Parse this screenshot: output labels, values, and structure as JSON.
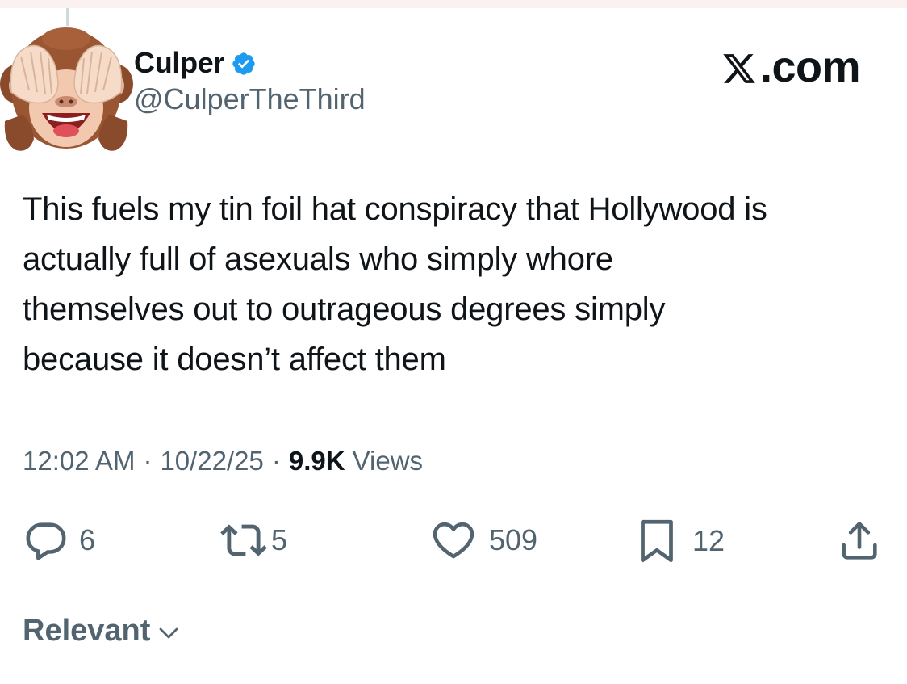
{
  "author": {
    "display_name": "Culper",
    "handle": "@CulperTheThird",
    "verified": true,
    "avatar_icon": "see-no-evil-monkey-icon"
  },
  "brand": {
    "label": ".com",
    "logo_icon": "x-logo-icon"
  },
  "tweet": {
    "text": "This fuels my tin foil hat conspiracy that Hollywood is\nactually full of asexuals who simply whore\nthemselves out to outrageous degrees simply\nbecause it doesn’t affect them"
  },
  "meta": {
    "time": "12:02 AM",
    "separator": "·",
    "date": "10/22/25",
    "views_count": "9.9K",
    "views_label": "Views"
  },
  "actions": {
    "replies": "6",
    "reposts": "5",
    "likes": "509",
    "bookmarks": "12"
  },
  "replies_sort": {
    "label": "Relevant"
  },
  "colors": {
    "text": "#0f1419",
    "secondary": "#536471",
    "verified_blue": "#1d9bf0"
  }
}
